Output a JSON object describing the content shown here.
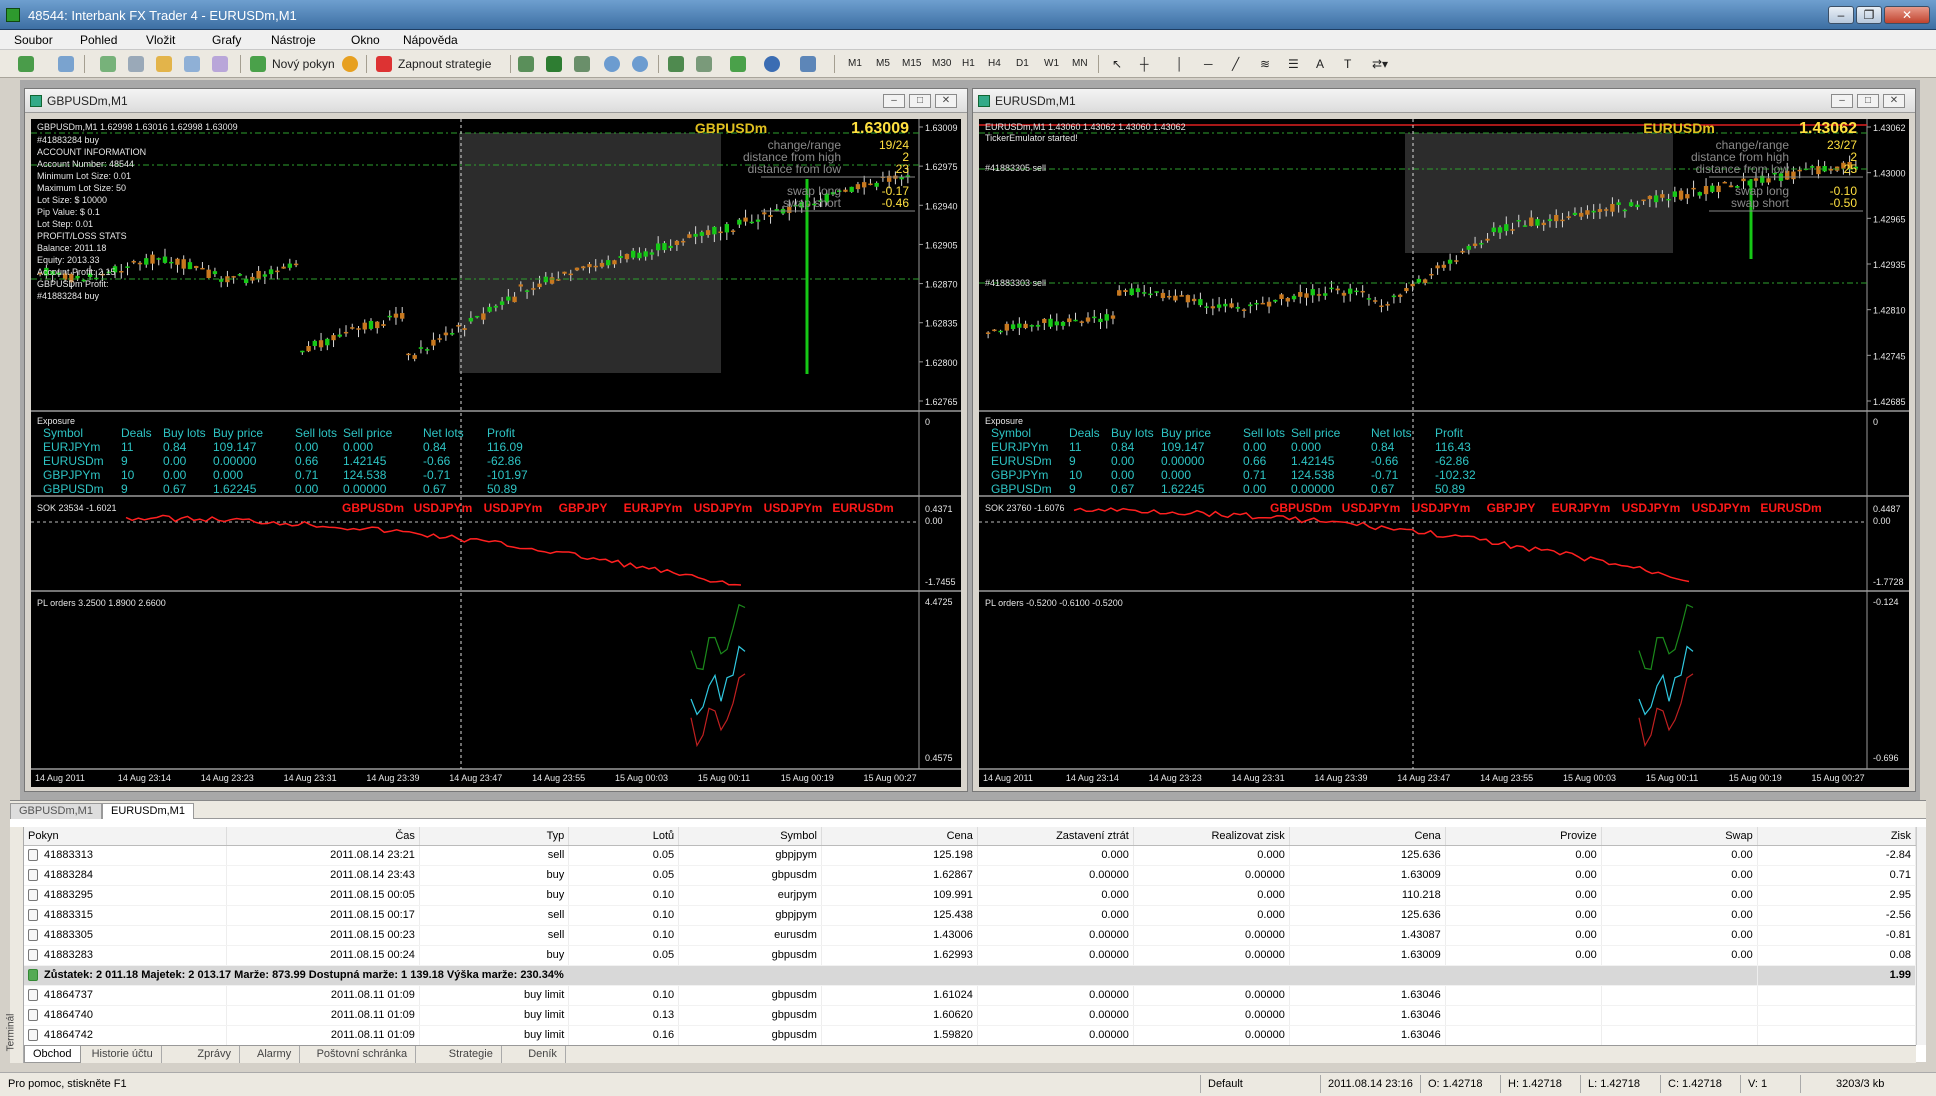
{
  "app": {
    "title": "48544: Interbank FX Trader 4 - EURUSDm,M1"
  },
  "menu": [
    "Soubor",
    "Pohled",
    "Vložit",
    "Grafy",
    "Nástroje",
    "Okno",
    "Nápověda"
  ],
  "toolbar": {
    "new_order": "Nový pokyn",
    "strategies": "Zapnout strategie",
    "timeframes": [
      "M1",
      "M5",
      "M15",
      "M30",
      "H1",
      "H4",
      "D1",
      "W1",
      "MN"
    ]
  },
  "colors": {
    "up": "#16c816",
    "down": "#c8781e",
    "ind": "#ff1414",
    "grid": "#2a2a2a",
    "label": "#2ec4c4"
  },
  "exposure_headers": [
    "Symbol",
    "Deals",
    "Buy lots",
    "Buy price",
    "Sell lots",
    "Sell price",
    "Net lots",
    "Profit"
  ],
  "sok_symbols": [
    "GBPUSDm",
    "USDJPYm",
    "USDJPYm",
    "GBPJPY",
    "EURJPYm",
    "USDJPYm",
    "USDJPYm",
    "EURUSDm"
  ],
  "left": {
    "title": "GBPUSDm,M1",
    "head": "GBPUSDm,M1  1.62998 1.63016 1.62998 1.63009",
    "sym": "GBPUSDm",
    "price": "1.63009",
    "stats": [
      {
        "label": "change/range",
        "value": "19/24"
      },
      {
        "label": "distance from high",
        "value": "2"
      },
      {
        "label": "distance from low",
        "value": "23"
      },
      {
        "label": "swap long",
        "value": "-0.17"
      },
      {
        "label": "swap short",
        "value": "-0.46"
      }
    ],
    "account": [
      "#41883284 buy",
      "ACCOUNT INFORMATION",
      "Account Number: 48544",
      "Minimum Lot Size: 0.01",
      "Maximum Lot Size: 50",
      "Lot Size: $ 10000",
      "Pip Value: $ 0.1",
      "Lot Step: 0.01",
      "PROFIT/LOSS STATS",
      "Balance: 2011.18",
      "Equity: 2013.33",
      "Account Profit: 2.15",
      "GBPUSDm Profit: ",
      "#41883284 buy"
    ],
    "yticks": [
      "1.63009",
      "1.62975",
      "1.62940",
      "1.62905",
      "1.62870",
      "1.62835",
      "1.62800",
      "1.62765"
    ],
    "exposure": [
      [
        "EURJPYm",
        "11",
        "0.84",
        "109.147",
        "0.00",
        "0.000",
        "0.84",
        "116.09"
      ],
      [
        "EURUSDm",
        "9",
        "0.00",
        "0.00000",
        "0.66",
        "1.42145",
        "-0.66",
        "-62.86"
      ],
      [
        "GBPJPYm",
        "10",
        "0.00",
        "0.000",
        "0.71",
        "124.538",
        "-0.71",
        "-101.97"
      ],
      [
        "GBPUSDm",
        "9",
        "0.67",
        "1.62245",
        "0.00",
        "0.00000",
        "0.67",
        "50.89"
      ]
    ],
    "exposure_title": "Exposure",
    "exp_scale": "0",
    "sok_title": "SOK 23534 -1.6021",
    "sok_scale": [
      "0.4371",
      "0.00",
      "-1.7455"
    ],
    "pl_title": "PL orders 3.2500 1.8900 2.6600",
    "pl_scale": [
      "4.4725",
      "0.4575"
    ],
    "xlabels": [
      "14 Aug 2011",
      "14 Aug 23:14",
      "14 Aug 23:23",
      "14 Aug 23:31",
      "14 Aug 23:39",
      "14 Aug 23:47",
      "14 Aug 23:55",
      "15 Aug 00:03",
      "15 Aug 00:11",
      "15 Aug 00:19",
      "15 Aug 00:27"
    ]
  },
  "right": {
    "title": "EURUSDm,M1",
    "head": "EURUSDm,M1  1.43060 1.43062 1.43060 1.43062",
    "ticker": "TickerEmulator started!",
    "sym": "EURUSDm",
    "price": "1.43062",
    "stats": [
      {
        "label": "change/range",
        "value": "23/27"
      },
      {
        "label": "distance from high",
        "value": "2"
      },
      {
        "label": "distance from low",
        "value": "25"
      },
      {
        "label": "swap long",
        "value": "-0.10"
      },
      {
        "label": "swap short",
        "value": "-0.50"
      }
    ],
    "orders": [
      "#41883305 sell",
      "#41883303 sell"
    ],
    "yticks": [
      "1.43062",
      "1.43000",
      "1.42965",
      "1.42935",
      "1.42810",
      "1.42745",
      "1.42685"
    ],
    "exposure": [
      [
        "EURJPYm",
        "11",
        "0.84",
        "109.147",
        "0.00",
        "0.000",
        "0.84",
        "116.43"
      ],
      [
        "EURUSDm",
        "9",
        "0.00",
        "0.00000",
        "0.66",
        "1.42145",
        "-0.66",
        "-62.86"
      ],
      [
        "GBPJPYm",
        "10",
        "0.00",
        "0.000",
        "0.71",
        "124.538",
        "-0.71",
        "-102.32"
      ],
      [
        "GBPUSDm",
        "9",
        "0.67",
        "1.62245",
        "0.00",
        "0.00000",
        "0.67",
        "50.89"
      ]
    ],
    "exposure_title": "Exposure",
    "exp_scale": "0",
    "sok_title": "SOK 23760 -1.6076",
    "sok_scale": [
      "0.4487",
      "0.00",
      "-1.7728"
    ],
    "pl_title": "PL orders -0.5200 -0.6100 -0.5200",
    "pl_scale": [
      "-0.124",
      "-0.696"
    ],
    "xlabels": [
      "14 Aug 2011",
      "14 Aug 23:14",
      "14 Aug 23:23",
      "14 Aug 23:31",
      "14 Aug 23:39",
      "14 Aug 23:47",
      "14 Aug 23:55",
      "15 Aug 00:03",
      "15 Aug 00:11",
      "15 Aug 00:19",
      "15 Aug 00:27"
    ]
  },
  "window_tabs": [
    "GBPUSDm,M1",
    "EURUSDm,M1"
  ],
  "terminal": {
    "label": "Terminál",
    "headers": [
      "Pokyn",
      "Čas",
      "Typ",
      "Lotů",
      "Symbol",
      "Cena",
      "Zastavení ztrát",
      "Realizovat zisk",
      "Cena",
      "Provize",
      "Swap",
      "Zisk"
    ],
    "rows": [
      [
        "41883313",
        "2011.08.14 23:21",
        "sell",
        "0.05",
        "gbpjpym",
        "125.198",
        "0.000",
        "0.000",
        "125.636",
        "0.00",
        "0.00",
        "-2.84"
      ],
      [
        "41883284",
        "2011.08.14 23:43",
        "buy",
        "0.05",
        "gbpusdm",
        "1.62867",
        "0.00000",
        "0.00000",
        "1.63009",
        "0.00",
        "0.00",
        "0.71"
      ],
      [
        "41883295",
        "2011.08.15 00:05",
        "buy",
        "0.10",
        "eurjpym",
        "109.991",
        "0.000",
        "0.000",
        "110.218",
        "0.00",
        "0.00",
        "2.95"
      ],
      [
        "41883315",
        "2011.08.15 00:17",
        "sell",
        "0.10",
        "gbpjpym",
        "125.438",
        "0.000",
        "0.000",
        "125.636",
        "0.00",
        "0.00",
        "-2.56"
      ],
      [
        "41883305",
        "2011.08.15 00:23",
        "sell",
        "0.10",
        "eurusdm",
        "1.43006",
        "0.00000",
        "0.00000",
        "1.43087",
        "0.00",
        "0.00",
        "-0.81"
      ],
      [
        "41883283",
        "2011.08.15 00:24",
        "buy",
        "0.05",
        "gbpusdm",
        "1.62993",
        "0.00000",
        "0.00000",
        "1.63009",
        "0.00",
        "0.00",
        "0.08"
      ]
    ],
    "summary": "Zůstatek: 2 011.18  Majetek: 2 013.17  Marže: 873.99  Dostupná marže: 1 139.18  Výška marže: 230.34%",
    "summary_total": "1.99",
    "pending": [
      [
        "41864737",
        "2011.08.11 01:09",
        "buy limit",
        "0.10",
        "gbpusdm",
        "1.61024",
        "0.00000",
        "0.00000",
        "1.63046"
      ],
      [
        "41864740",
        "2011.08.11 01:09",
        "buy limit",
        "0.13",
        "gbpusdm",
        "1.60620",
        "0.00000",
        "0.00000",
        "1.63046"
      ],
      [
        "41864742",
        "2011.08.11 01:09",
        "buy limit",
        "0.16",
        "gbpusdm",
        "1.59820",
        "0.00000",
        "0.00000",
        "1.63046"
      ]
    ],
    "tabs": [
      "Obchod",
      "Historie účtu",
      "Zprávy",
      "Alarmy",
      "Poštovní schránka",
      "Strategie",
      "Deník"
    ]
  },
  "status": {
    "help": "Pro pomoc, stiskněte F1",
    "profile": "Default",
    "time": "2011.08.14 23:16",
    "open": "O: 1.42718",
    "high": "H: 1.42718",
    "low": "L: 1.42718",
    "close": "C: 1.42718",
    "volume": "V: 1",
    "traffic": "3203/3 kb"
  }
}
